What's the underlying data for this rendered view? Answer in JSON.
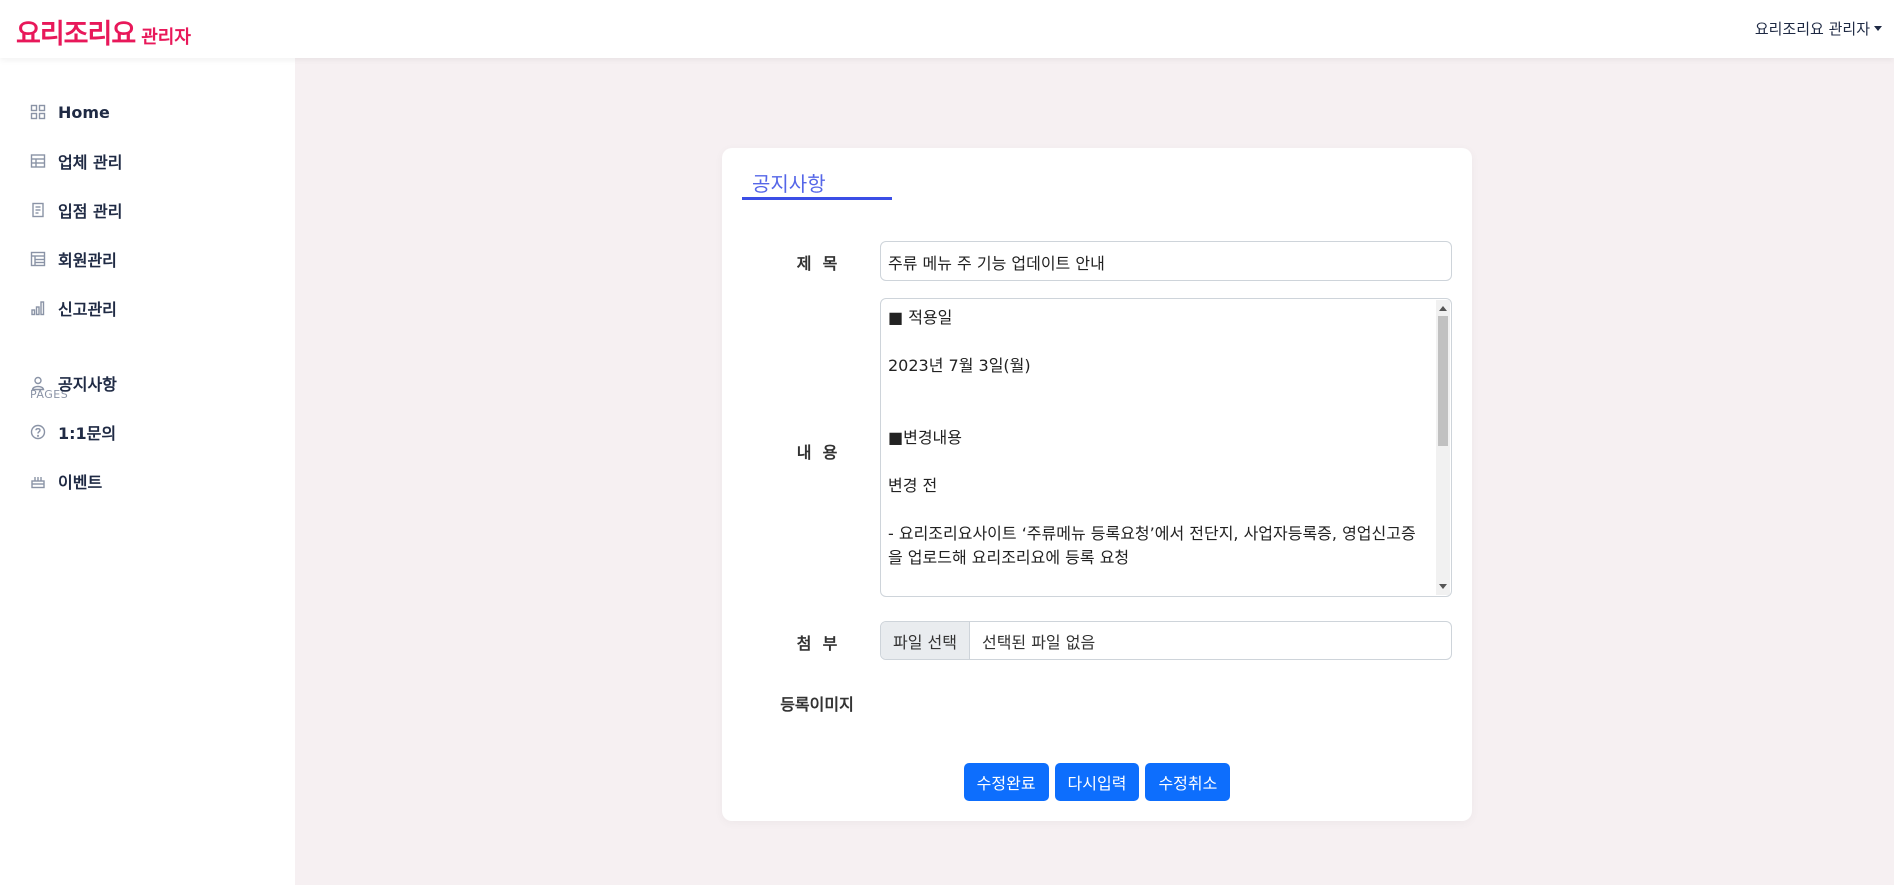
{
  "header": {
    "logo_main": "요리조리요",
    "logo_sub": "관리자",
    "user_menu": "요리조리요 관리자"
  },
  "sidebar": {
    "items": [
      {
        "label": "Home",
        "icon": "grid-icon"
      },
      {
        "label": "업체 관리",
        "icon": "layout-icon"
      },
      {
        "label": "입점 관리",
        "icon": "document-icon"
      },
      {
        "label": "회원관리",
        "icon": "table-icon"
      },
      {
        "label": "신고관리",
        "icon": "bar-chart-icon"
      }
    ],
    "section_label": "PAGES",
    "page_items": [
      {
        "label": "공지사항",
        "icon": "user-icon"
      },
      {
        "label": "1:1문의",
        "icon": "question-icon"
      },
      {
        "label": "이벤트",
        "icon": "cake-icon"
      }
    ]
  },
  "form": {
    "card_title": "공지사항",
    "title_label": "제  목",
    "title_value": "주류 메뉴 주 기능 업데이트 안내",
    "content_label": "내  용",
    "content_value": "■ 적용일\n\n2023년 7월 3일(월)\n\n\n■변경내용\n\n변경 전\n\n- 요리조리요사이트 ‘주류메뉴 등록요청’에서 전단지, 사업자등록증, 영업신고증을 업로드해 요리조리요에 등록 요청",
    "attach_label": "첨  부",
    "file_button": "파일 선택",
    "file_status": "선택된 파일 없음",
    "image_label": "등록이미지",
    "buttons": {
      "submit": "수정완료",
      "reset": "다시입력",
      "cancel": "수정취소"
    }
  },
  "colors": {
    "brand": "#e8185a",
    "accent": "#5566e8",
    "button": "#0d6efd",
    "background": "#f6f0f2"
  }
}
